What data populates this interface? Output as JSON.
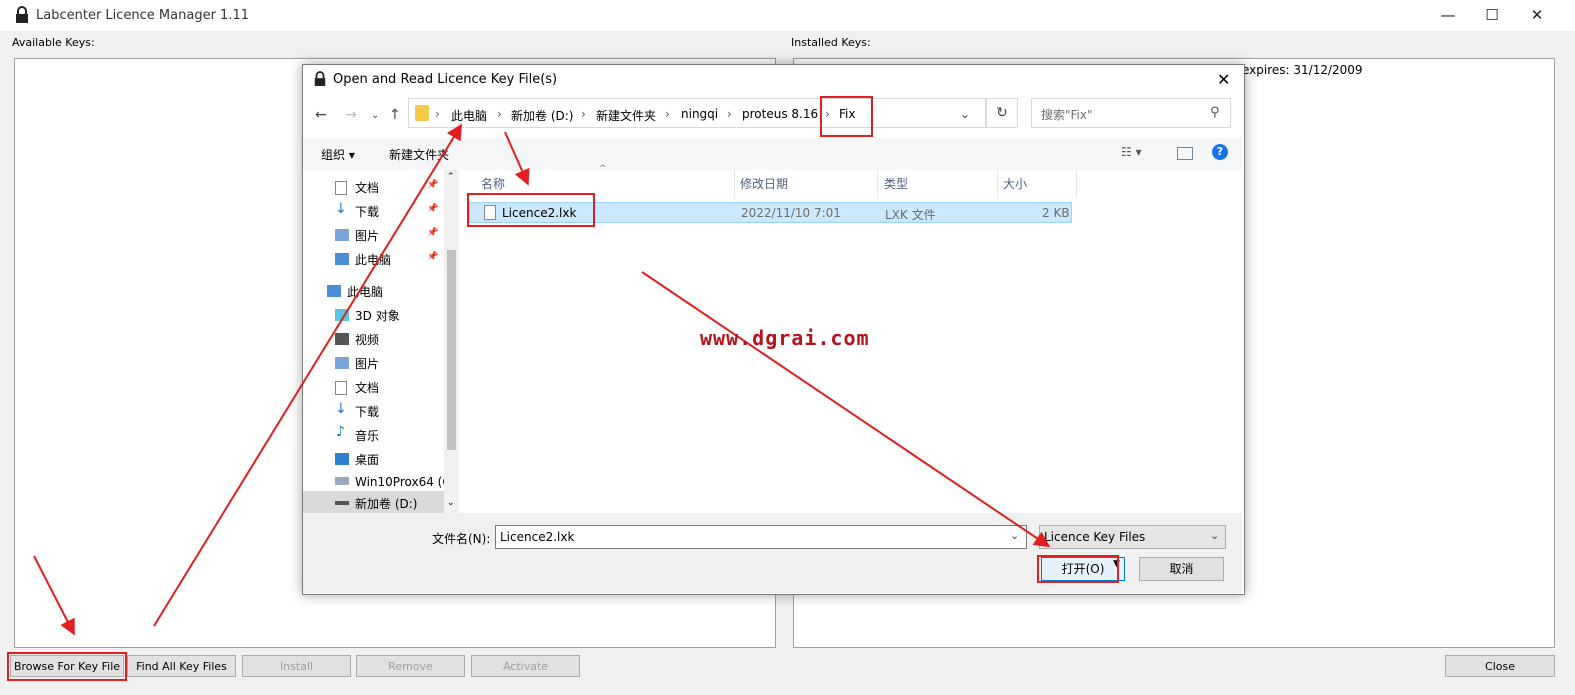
{
  "app": {
    "title": "Labcenter Licence Manager 1.11",
    "available_label": "Available Keys:",
    "installed_label": "Installed Keys:",
    "installed_text": "expires: 31/12/2009",
    "buttons": {
      "browse": "Browse For Key File",
      "find_all": "Find All Key Files",
      "install": "Install",
      "remove": "Remove",
      "activate": "Activate",
      "close": "Close"
    },
    "window_controls": {
      "minimize": "—",
      "maximize": "☐",
      "close": "✕"
    }
  },
  "dialog": {
    "title": "Open and Read Licence Key File(s)",
    "breadcrumb": [
      "此电脑",
      "新加卷 (D:)",
      "新建文件夹",
      "ningqi",
      "proteus 8.16",
      "Fix"
    ],
    "search_placeholder": "搜索\"Fix\"",
    "toolbar": {
      "organize": "组织 ▾",
      "new_folder": "新建文件夹"
    },
    "quick_access": [
      "文档",
      "下载",
      "图片",
      "此电脑"
    ],
    "this_pc": {
      "label": "此电脑",
      "items": [
        "3D 对象",
        "视频",
        "图片",
        "文档",
        "下载",
        "音乐",
        "桌面",
        "Win10Prox64 (C",
        "新加卷 (D:)"
      ]
    },
    "columns": {
      "name": "名称",
      "date": "修改日期",
      "type": "类型",
      "size": "大小"
    },
    "files": [
      {
        "name": "Licence2.lxk",
        "date": "2022/11/10 7:01",
        "type": "LXK 文件",
        "size": "2 KB"
      }
    ],
    "filename_label": "文件名(N):",
    "filename_value": "Licence2.lxk",
    "filter": "Licence Key Files",
    "open_button": "打开(O)",
    "cancel_button": "取消"
  },
  "watermark": "www.dgrai.com",
  "colors": {
    "annotation": "#e02020",
    "selection": "#cce8ff",
    "help": "#1a73e8"
  }
}
